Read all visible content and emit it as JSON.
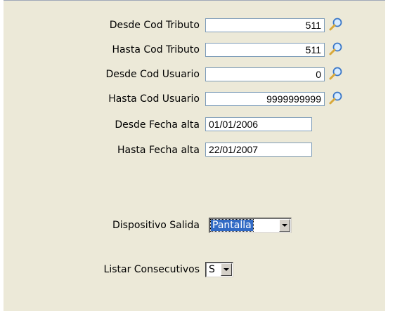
{
  "filters": [
    {
      "id": "desde-cod-tributo",
      "label": "Desde Cod Tributo",
      "value": "511",
      "lookup": true
    },
    {
      "id": "hasta-cod-tributo",
      "label": "Hasta Cod Tributo",
      "value": "511",
      "lookup": true
    },
    {
      "id": "desde-cod-usuario",
      "label": "Desde Cod Usuario",
      "value": "0",
      "lookup": true
    },
    {
      "id": "hasta-cod-usuario",
      "label": "Hasta Cod Usuario",
      "value": "9999999999",
      "lookup": true
    },
    {
      "id": "desde-fecha-alta",
      "label": "Desde Fecha alta",
      "value": "01/01/2006",
      "lookup": false
    },
    {
      "id": "hasta-fecha-alta",
      "label": "Hasta Fecha alta",
      "value": "22/01/2007",
      "lookup": false
    }
  ],
  "output_device": {
    "label": "Dispositivo Salida",
    "selected": "Pantalla"
  },
  "consecutive": {
    "label": "Listar Consecutivos",
    "selected": "S"
  },
  "icons": {
    "lookup": "magnifier-icon",
    "dropdown": "chevron-down-icon"
  },
  "colors": {
    "panel_bg": "#ece9d8",
    "field_border": "#7f9db9",
    "selection": "#316ac5"
  }
}
